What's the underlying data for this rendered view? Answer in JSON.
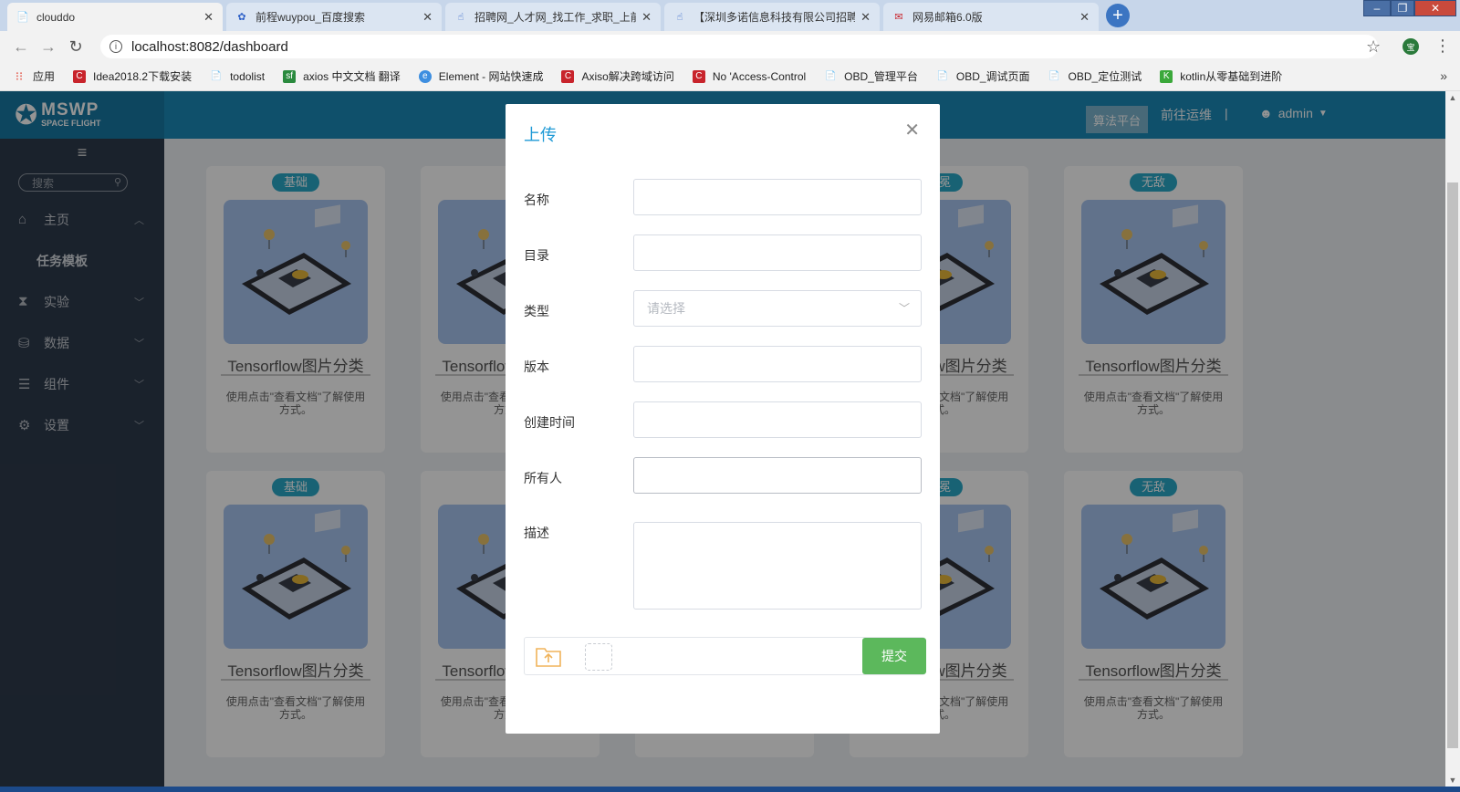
{
  "browser": {
    "tabs": [
      {
        "label": "clouddo",
        "icon": "page-icon"
      },
      {
        "label": "前程wuypou_百度搜索",
        "icon": "baidu-icon"
      },
      {
        "label": "招聘网_人才网_找工作_求职_上前",
        "icon": "hand-icon"
      },
      {
        "label": "【深圳多诺信息科技有限公司招聘",
        "icon": "hand-icon"
      },
      {
        "label": "网易邮箱6.0版",
        "icon": "mail163-icon"
      }
    ],
    "url": "localhost:8082/dashboard",
    "ext_label": "宝",
    "bookmarks": [
      {
        "label": "应用",
        "icon": "apps-grid-icon",
        "color": "#e24a3b"
      },
      {
        "label": "Idea2018.2下载安装",
        "icon": "c-icon",
        "color": "#c8242c"
      },
      {
        "label": "todolist",
        "icon": "page-icon",
        "color": "#ffffff"
      },
      {
        "label": "axios 中文文档 翻译",
        "icon": "sf-icon",
        "color": "#2a8a3e"
      },
      {
        "label": "Element - 网站快速成",
        "icon": "element-icon",
        "color": "#3d8ee0"
      },
      {
        "label": "Axiso解决跨域访问",
        "icon": "c-icon",
        "color": "#c8242c"
      },
      {
        "label": "No 'Access-Control",
        "icon": "c-icon",
        "color": "#c8242c"
      },
      {
        "label": "OBD_管理平台",
        "icon": "page-icon",
        "color": "#ffffff"
      },
      {
        "label": "OBD_调试页面",
        "icon": "page-icon",
        "color": "#ffffff"
      },
      {
        "label": "OBD_定位测试",
        "icon": "page-icon",
        "color": "#ffffff"
      },
      {
        "label": "kotlin从零基础到进阶",
        "icon": "kotlin-icon",
        "color": "#3aa83a"
      }
    ]
  },
  "app": {
    "logo_line1": "MSWP",
    "logo_line2": "SPACE FLIGHT",
    "header": {
      "algo_platform": "算法平台",
      "ops_link": "前往运维",
      "separator": "|",
      "user": "admin"
    },
    "sidebar": {
      "search_placeholder": "搜索",
      "items": [
        {
          "label": "主页",
          "icon": "home-icon"
        },
        {
          "label": "实验",
          "icon": "hourglass-icon"
        },
        {
          "label": "数据",
          "icon": "database-icon"
        },
        {
          "label": "组件",
          "icon": "list-icon"
        },
        {
          "label": "设置",
          "icon": "gear-icon"
        }
      ],
      "sub_item": "任务模板"
    },
    "cards": [
      {
        "badge": "基础",
        "title": "Tensorflow图片分类",
        "desc": "使用点击\"查看文档\"了解使用方式。"
      },
      {
        "badge": "",
        "title": "Tensorflow图片分类",
        "desc": "使用点击\"查看文档\"了解使用方式。"
      },
      {
        "badge": "",
        "title": "",
        "desc": ""
      },
      {
        "badge": "加冕",
        "title": "Tensorflow图片分类",
        "desc": "使用点击\"查看文档\"了解使用方式。"
      },
      {
        "badge": "无敌",
        "title": "Tensorflow图片分类",
        "desc": "使用点击\"查看文档\"了解使用方式。"
      }
    ],
    "colors": {
      "header": "#1a8bb8",
      "sidebar": "#2e3b4c",
      "badge": "#2aa9c9",
      "submit": "#5cb85c",
      "modal_title": "#1f9ad6"
    }
  },
  "modal": {
    "title": "上传",
    "fields": {
      "name": {
        "label": "名称",
        "value": ""
      },
      "directory": {
        "label": "目录",
        "value": ""
      },
      "type": {
        "label": "类型",
        "placeholder": "请选择"
      },
      "version": {
        "label": "版本",
        "value": ""
      },
      "created": {
        "label": "创建时间",
        "value": ""
      },
      "owner": {
        "label": "所有人",
        "value": ""
      },
      "description": {
        "label": "描述",
        "value": ""
      }
    },
    "submit_label": "提交"
  }
}
